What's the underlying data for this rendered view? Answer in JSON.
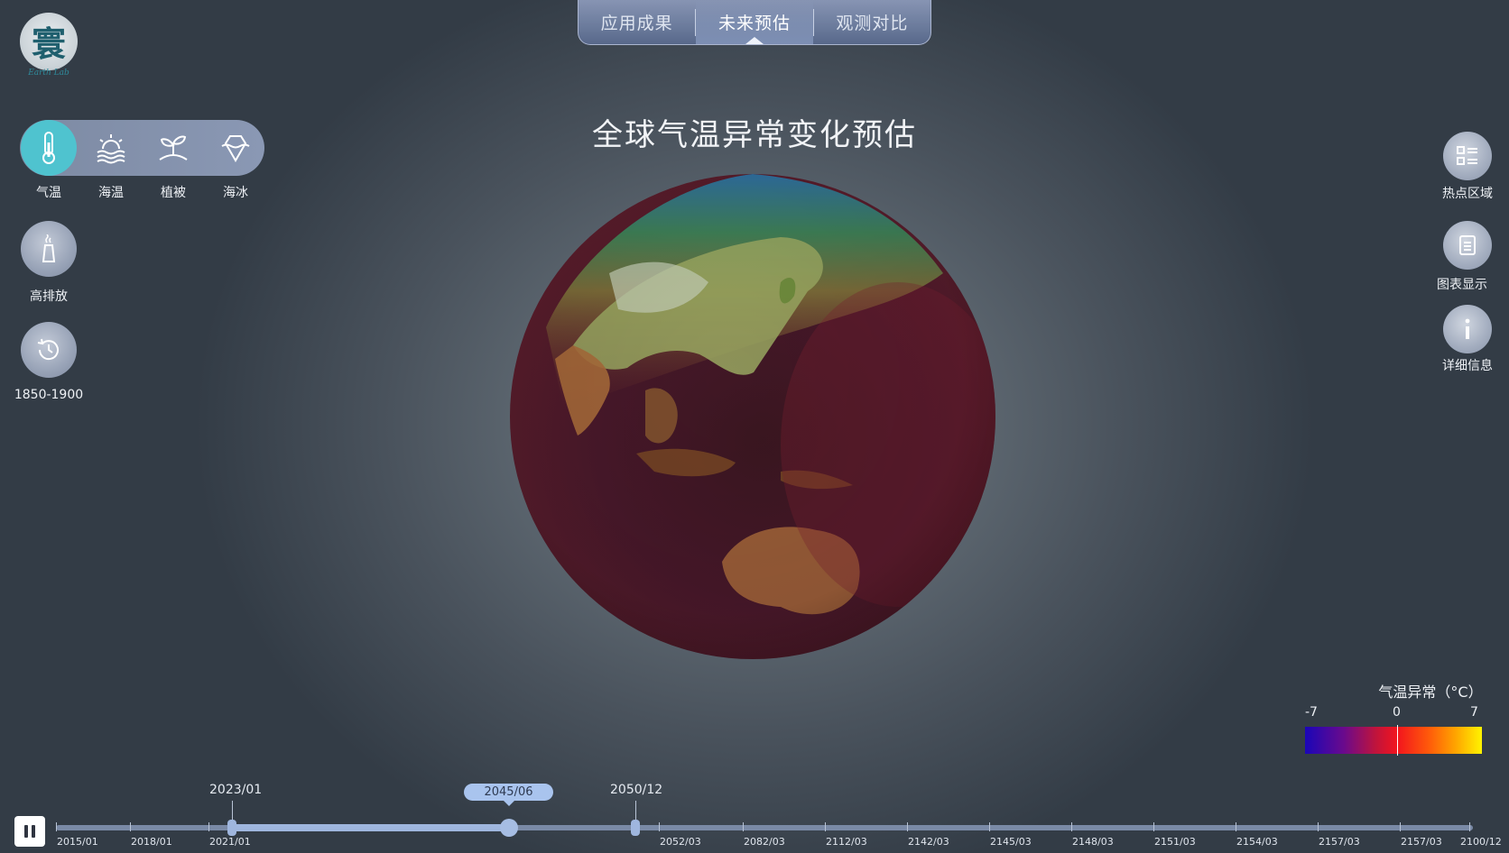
{
  "logo": {
    "glyph": "寰",
    "subtitle": "Earth Lab"
  },
  "top_tabs": [
    {
      "label": "应用成果",
      "active": false
    },
    {
      "label": "未来预估",
      "active": true
    },
    {
      "label": "观测对比",
      "active": false
    }
  ],
  "title": "全球气温异常变化预估",
  "variables": [
    {
      "label": "气温",
      "icon": "thermometer-icon",
      "active": true
    },
    {
      "label": "海温",
      "icon": "sea-temperature-icon",
      "active": false
    },
    {
      "label": "植被",
      "icon": "vegetation-icon",
      "active": false
    },
    {
      "label": "海冰",
      "icon": "sea-ice-icon",
      "active": false
    }
  ],
  "scenario": {
    "label": "高排放",
    "icon": "factory-chimney-icon"
  },
  "baseline": {
    "label": "1850-1900",
    "icon": "history-clock-icon"
  },
  "right_buttons": [
    {
      "label": "热点区域",
      "icon": "list-grid-icon"
    },
    {
      "label": "图表显示",
      "icon": "document-icon"
    },
    {
      "label": "详细信息",
      "icon": "info-icon"
    }
  ],
  "legend": {
    "title": "气温异常（°C）",
    "min": "-7",
    "mid": "0",
    "max": "7",
    "colors": [
      "#1a06b8",
      "#c0143c",
      "#f2141e",
      "#ffa400",
      "#fff400"
    ]
  },
  "timeline": {
    "playing": true,
    "range_start": "2023/01",
    "range_end": "2050/12",
    "current": "2045/06",
    "ticks": [
      "2015/01",
      "2018/01",
      "2021/01",
      "2052/03",
      "2082/03",
      "2112/03",
      "2142/03",
      "2145/03",
      "2148/03",
      "2151/03",
      "2154/03",
      "2157/03",
      "2157/03",
      "2100/12"
    ]
  }
}
